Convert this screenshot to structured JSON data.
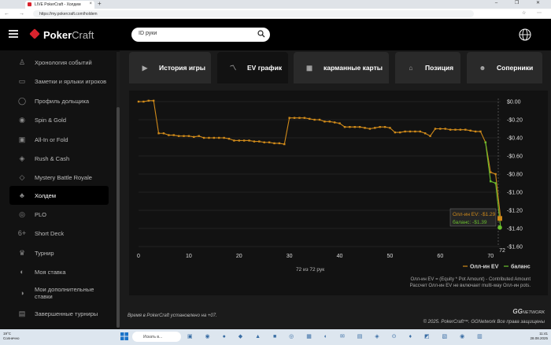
{
  "browser": {
    "tab_title": "LIVE PokerCraft - Холдем",
    "url": "https://my.pokercraft.com/holdem",
    "new_tab_symbol": "+",
    "close_symbol": "×",
    "window_controls": "–  ❐  ✕",
    "nav_arrows": "←  →  ⟳",
    "toolbar_icons": "☆ ⋯"
  },
  "header": {
    "logo_poker": "Poker",
    "logo_craft": "Craft",
    "search_placeholder": "ID руки"
  },
  "sidebar": {
    "items": [
      {
        "label": "Хронология событий",
        "icon": "timeline-icon"
      },
      {
        "label": "Заметки и ярлыки игроков",
        "icon": "notes-icon"
      },
      {
        "label": "Профиль дольщика",
        "icon": "profile-icon"
      },
      {
        "label": "Spin & Gold",
        "icon": "spin-icon"
      },
      {
        "label": "All-In or Fold",
        "icon": "allin-icon"
      },
      {
        "label": "Rush & Cash",
        "icon": "rush-icon"
      },
      {
        "label": "Mystery Battle Royale",
        "icon": "mystery-icon"
      },
      {
        "label": "Холдем",
        "icon": "cards-icon"
      },
      {
        "label": "PLO",
        "icon": "plo-icon"
      },
      {
        "label": "Short Deck",
        "icon": "shortdeck-icon"
      },
      {
        "label": "Турнир",
        "icon": "trophy-icon"
      },
      {
        "label": "Моя ставка",
        "icon": "stake-icon"
      },
      {
        "label": "Мои дополнительные ставки",
        "icon": "extra-stake-icon"
      },
      {
        "label": "Завершенные турниры",
        "icon": "finished-icon"
      }
    ],
    "active_index": 7
  },
  "tabs": [
    {
      "label": "История игры",
      "icon": "video-icon"
    },
    {
      "label": "EV график",
      "icon": "chart-icon"
    },
    {
      "label": "карманные карты",
      "icon": "grid-icon"
    },
    {
      "label": "Позиция",
      "icon": "position-icon"
    },
    {
      "label": "Соперники",
      "icon": "opponent-icon"
    }
  ],
  "active_tab": 1,
  "chart_labels": {
    "hands_count": "72 из 72 рук",
    "formula_line1": "Олл-ин EV = (Equity * Pot Amount) - Contributed Amount",
    "formula_line2": "Рассчет Олл-ин EV не включает multi-way Олл-ин pots.",
    "tooltip_ev": "Олл-ин EV: -$1.29",
    "tooltip_balance": "баланс: -$1.39",
    "last_tick": "72"
  },
  "chart_data": {
    "type": "line",
    "xlim": [
      0,
      72
    ],
    "ylim": [
      -1.6,
      0.0
    ],
    "x_ticks": [
      0,
      10,
      20,
      30,
      40,
      50,
      60,
      70
    ],
    "y_ticks": [
      "$0.00",
      "-$0.20",
      "-$0.40",
      "-$0.60",
      "-$0.80",
      "-$1.00",
      "-$1.20",
      "-$1.40",
      "-$1.60"
    ],
    "y_tick_values": [
      0,
      -0.2,
      -0.4,
      -0.6,
      -0.8,
      -1.0,
      -1.2,
      -1.4,
      -1.6
    ],
    "grid": true,
    "legend_position": "bottom-right",
    "series": [
      {
        "name": "Олл-ин EV",
        "color": "#d08a1a",
        "values": [
          0,
          0,
          0.01,
          0.01,
          -0.35,
          -0.35,
          -0.37,
          -0.37,
          -0.38,
          -0.38,
          -0.38,
          -0.39,
          -0.38,
          -0.4,
          -0.4,
          -0.4,
          -0.4,
          -0.4,
          -0.41,
          -0.43,
          -0.43,
          -0.43,
          -0.43,
          -0.44,
          -0.44,
          -0.45,
          -0.45,
          -0.46,
          -0.46,
          -0.47,
          -0.18,
          -0.18,
          -0.18,
          -0.18,
          -0.19,
          -0.2,
          -0.2,
          -0.22,
          -0.22,
          -0.23,
          -0.24,
          -0.28,
          -0.28,
          -0.28,
          -0.28,
          -0.29,
          -0.3,
          -0.29,
          -0.28,
          -0.28,
          -0.29,
          -0.34,
          -0.34,
          -0.33,
          -0.33,
          -0.33,
          -0.33,
          -0.35,
          -0.38,
          -0.3,
          -0.3,
          -0.3,
          -0.31,
          -0.31,
          -0.31,
          -0.31,
          -0.32,
          -0.33,
          -0.33,
          -0.45,
          -0.78,
          -0.8,
          -1.29
        ]
      },
      {
        "name": "баланс",
        "color": "#6abf2e",
        "x": [
          69,
          70,
          71,
          72
        ],
        "values": [
          -0.45,
          -0.88,
          -0.9,
          -1.39
        ]
      }
    ]
  },
  "footer": {
    "timezone_note": "Время в PokerCraft установлено на +07.",
    "copyright": "© 2025. PokerCraft™. GGNetwork Все права защищены",
    "gg_logo": "GG",
    "gg_network": "NETWORK"
  },
  "taskbar": {
    "weather_temp": "19°C",
    "weather_text": "Солнечно",
    "search_placeholder": "Искать в...",
    "time": "11:41",
    "date": "28.08.2025",
    "pinned_icons": "▣ ◉ ● ◆ ▲ ■ ◎ ▦ ◐ ✉ ▤ ◈ ⊙ ♦ ◩ ▧ ◉ ▥"
  },
  "colors": {
    "accent_red": "#d9232d",
    "ev_line": "#d08a1a",
    "balance_line": "#6abf2e"
  }
}
